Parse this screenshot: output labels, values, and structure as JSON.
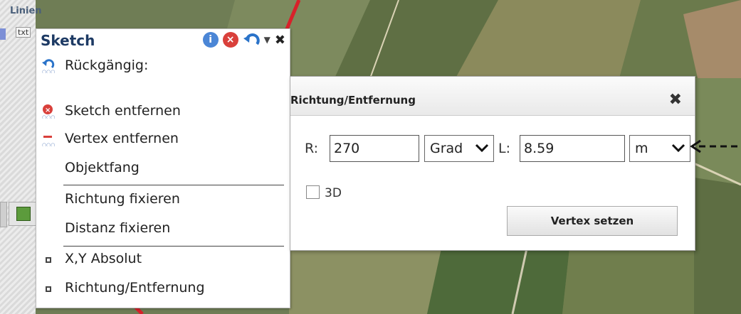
{
  "map": {
    "background_colors": [
      "#6f7d55",
      "#8b8a5c",
      "#5f6f44",
      "#a6a07a",
      "#7a8a5a"
    ]
  },
  "layers_panel": {
    "title": "Linien",
    "badge": "txt"
  },
  "sketch_menu": {
    "title": "Sketch",
    "header_icons": [
      "info-icon",
      "delete-icon",
      "undo-icon",
      "dropdown-icon",
      "close-icon"
    ],
    "info_glyph": "i",
    "delete_glyph": "×",
    "dropdown_glyph": "▼",
    "close_glyph": "✖",
    "items": [
      {
        "label": "Rückgängig:",
        "icon": "undo-icon"
      },
      {
        "label": "Sketch entfernen",
        "icon": "delete-icon"
      },
      {
        "label": "Vertex entfernen",
        "icon": "minus-icon"
      },
      {
        "label": "Objektfang",
        "icon": ""
      },
      {
        "label": "Richtung fixieren",
        "icon": ""
      },
      {
        "label": "Distanz fixieren",
        "icon": ""
      },
      {
        "label": "X,Y Absolut",
        "icon": "bullet-icon"
      },
      {
        "label": "Richtung/Entfernung",
        "icon": "bullet-icon"
      }
    ]
  },
  "dialog": {
    "title": "Richtung/Entfernung",
    "close_glyph": "✖",
    "r_label": "R:",
    "r_value": "270",
    "angle_unit": "Grad",
    "l_label": "L:",
    "l_value": "8.59",
    "length_unit": "m",
    "checkbox_label": "3D",
    "checkbox_checked": false,
    "submit_label": "Vertex setzen"
  },
  "colors": {
    "title_blue": "#1d3a64",
    "info_blue": "#4b86d6",
    "delete_red": "#d9403b",
    "undo_blue": "#2a73c9"
  }
}
